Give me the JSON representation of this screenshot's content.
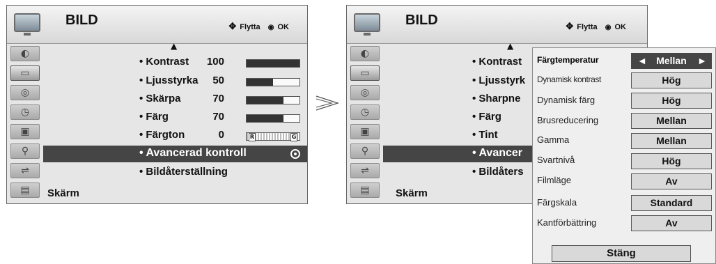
{
  "left_menu": {
    "title": "BILD",
    "hint_move": "Flytta",
    "hint_ok": "OK",
    "items": [
      {
        "label": "• Kontrast",
        "value": "100",
        "level": 1.0
      },
      {
        "label": "• Ljusstyrka",
        "value": "50",
        "level": 0.5
      },
      {
        "label": "• Skärpa",
        "value": "70",
        "level": 0.7
      },
      {
        "label": "• Färg",
        "value": "70",
        "level": 0.7
      },
      {
        "label": "• Färgton",
        "value": "0",
        "tint_left": "R",
        "tint_right": "G"
      }
    ],
    "selected": "• Avancerad kontroll",
    "reset": "• Bildåterställning",
    "footer": "Skärm"
  },
  "right_menu": {
    "title": "BILD",
    "hint_move": "Flytta",
    "hint_ok": "OK",
    "items": [
      "• Kontrast",
      "• Ljusstyrk",
      "• Sharpne",
      "• Färg",
      "• Tint"
    ],
    "selected": "• Avancer",
    "reset": "• Bildåters",
    "footer": "Skärm"
  },
  "popup": {
    "rows": [
      {
        "label": "Färgtemperatur",
        "value": "Mellan"
      },
      {
        "label": "Dynamisk kontrast",
        "value": "Hög"
      },
      {
        "label": "Dynamisk färg",
        "value": "Hög"
      },
      {
        "label": "Brusreducering",
        "value": "Mellan"
      },
      {
        "label": "Gamma",
        "value": "Mellan"
      },
      {
        "label": "Svartnivå",
        "value": "Hög"
      },
      {
        "label": "Filmläge",
        "value": "Av"
      },
      {
        "label": "Färgskala",
        "value": "Standard"
      },
      {
        "label": "Kantförbättring",
        "value": "Av"
      }
    ],
    "close": "Stäng",
    "arrow_left": "◄",
    "arrow_right": "►"
  },
  "icons": {
    "menu_icons": [
      "satellite-dish-icon",
      "picture-icon",
      "audio-icon",
      "clock-icon",
      "lock-icon",
      "input-icon",
      "usb-icon",
      "movie-icon"
    ],
    "accent_color": "#454545"
  }
}
